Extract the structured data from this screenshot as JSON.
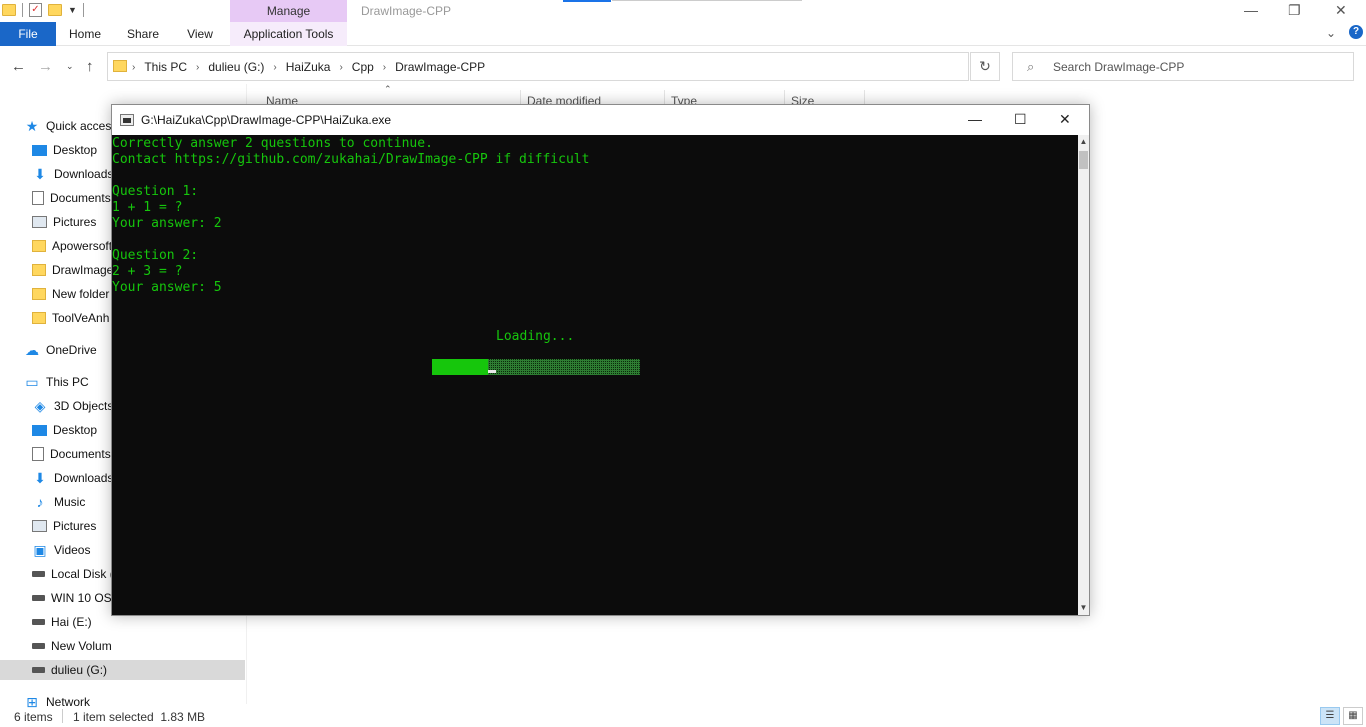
{
  "window": {
    "title": "DrawImage-CPP",
    "manage_label": "Manage",
    "minimize": "—",
    "restore": "❐",
    "close": "✕"
  },
  "ribbon": {
    "tabs": [
      "File",
      "Home",
      "Share",
      "View",
      "Application Tools"
    ],
    "expand_glyph": "⌄"
  },
  "address": {
    "breadcrumbs": [
      "This PC",
      "dulieu (G:)",
      "HaiZuka",
      "Cpp",
      "DrawImage-CPP"
    ],
    "search_placeholder": "Search DrawImage-CPP"
  },
  "columns": [
    "Name",
    "Date modified",
    "Type",
    "Size"
  ],
  "nav_pane": {
    "items": [
      {
        "label": "Quick access",
        "icon": "star-icon"
      },
      {
        "label": "Desktop",
        "icon": "desktop-icon"
      },
      {
        "label": "Downloads",
        "icon": "download-icon"
      },
      {
        "label": "Documents",
        "icon": "documents-icon"
      },
      {
        "label": "Pictures",
        "icon": "pictures-icon"
      },
      {
        "label": "Apowersoft",
        "icon": "folder-icon"
      },
      {
        "label": "DrawImage",
        "icon": "folder-icon"
      },
      {
        "label": "New folder",
        "icon": "folder-icon"
      },
      {
        "label": "ToolVeAnh",
        "icon": "folder-icon"
      },
      {
        "label": "OneDrive",
        "icon": "cloud-icon"
      },
      {
        "label": "This PC",
        "icon": "computer-icon"
      },
      {
        "label": "3D Objects",
        "icon": "cube-icon"
      },
      {
        "label": "Desktop",
        "icon": "desktop-icon"
      },
      {
        "label": "Documents",
        "icon": "documents-icon"
      },
      {
        "label": "Downloads",
        "icon": "download-icon"
      },
      {
        "label": "Music",
        "icon": "music-icon"
      },
      {
        "label": "Pictures",
        "icon": "pictures-icon"
      },
      {
        "label": "Videos",
        "icon": "video-icon"
      },
      {
        "label": "Local Disk (",
        "icon": "drive-icon"
      },
      {
        "label": "WIN 10 OS",
        "icon": "drive-icon"
      },
      {
        "label": "Hai (E:)",
        "icon": "drive-icon"
      },
      {
        "label": "New Volume (F:)",
        "icon": "drive-icon"
      },
      {
        "label": "dulieu (G:)",
        "icon": "drive-icon"
      },
      {
        "label": "Network",
        "icon": "network-icon"
      }
    ],
    "selected_index": 22
  },
  "status": {
    "item_count": "6 items",
    "selection": "1 item selected  1.83 MB"
  },
  "console": {
    "title": "G:\\HaiZuka\\Cpp\\DrawImage-CPP\\HaiZuka.exe",
    "lines": [
      "Correctly answer 2 questions to continue.",
      "Contact https://github.com/zukahai/DrawImage-CPP if difficult",
      "",
      "Question 1:",
      "1 + 1 = ?",
      "Your answer: 2",
      "",
      "Question 2:",
      "2 + 3 = ?",
      "Your answer: 5"
    ],
    "loading_text": "Loading...",
    "progress_fraction": 0.27,
    "text_color": "#16c60c",
    "background_color": "#0c0c0c"
  }
}
